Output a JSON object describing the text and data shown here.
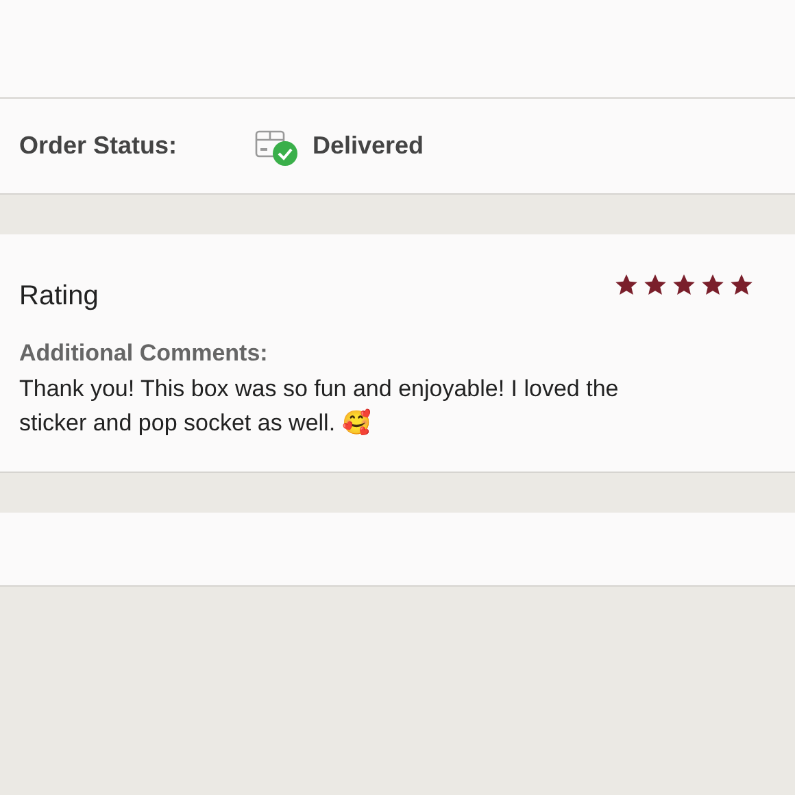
{
  "order_status": {
    "label": "Order Status:",
    "value": "Delivered",
    "delivered": true
  },
  "rating": {
    "title": "Rating",
    "stars": 5,
    "comments_label": "Additional Comments:",
    "comments": "Thank you! This box was so fun and enjoyable! I loved the sticker and pop socket as well. 🥰"
  }
}
